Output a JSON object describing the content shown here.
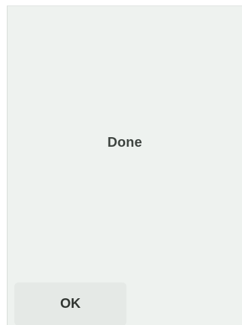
{
  "dialog": {
    "message": "Done",
    "ok_label": "OK"
  },
  "colors": {
    "panel_background": "#eef2ef",
    "button_background": "#e5e9e6",
    "text": "#3f4541"
  }
}
